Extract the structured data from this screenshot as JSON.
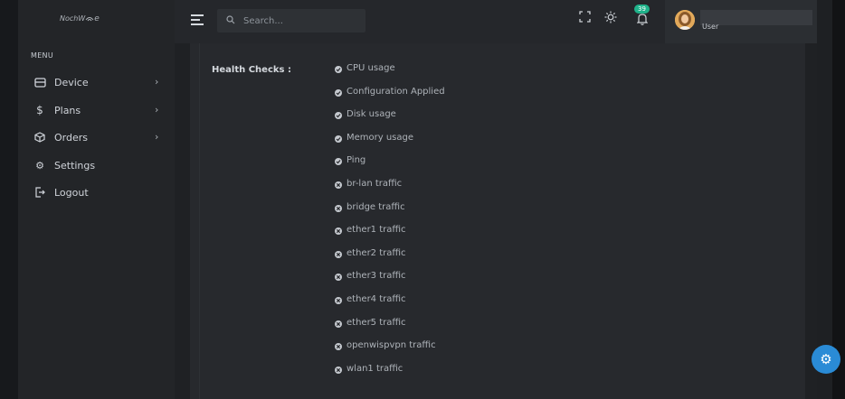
{
  "logo": {
    "text": "NochW",
    "tail": "e"
  },
  "sidebar": {
    "menu_title": "MENU",
    "items": [
      {
        "label": "Device",
        "icon": "device-icon",
        "has_submenu": true
      },
      {
        "label": "Plans",
        "icon": "dollar-icon",
        "has_submenu": true
      },
      {
        "label": "Orders",
        "icon": "box-icon",
        "has_submenu": true
      },
      {
        "label": "Settings",
        "icon": "gear-icon",
        "has_submenu": false
      },
      {
        "label": "Logout",
        "icon": "logout-icon",
        "has_submenu": false
      }
    ]
  },
  "header": {
    "search_placeholder": "Search...",
    "notification_count": "39",
    "user_role": "User"
  },
  "main": {
    "health_label": "Health Checks :",
    "checks": [
      {
        "label": "CPU usage",
        "status": "ok"
      },
      {
        "label": "Configuration Applied",
        "status": "ok"
      },
      {
        "label": "Disk usage",
        "status": "ok"
      },
      {
        "label": "Memory usage",
        "status": "ok"
      },
      {
        "label": "Ping",
        "status": "ok"
      },
      {
        "label": "br-lan traffic",
        "status": "fail"
      },
      {
        "label": "bridge traffic",
        "status": "fail"
      },
      {
        "label": "ether1 traffic",
        "status": "fail"
      },
      {
        "label": "ether2 traffic",
        "status": "fail"
      },
      {
        "label": "ether3 traffic",
        "status": "fail"
      },
      {
        "label": "ether4 traffic",
        "status": "fail"
      },
      {
        "label": "ether5 traffic",
        "status": "fail"
      },
      {
        "label": "openwispvpn traffic",
        "status": "fail"
      },
      {
        "label": "wlan1 traffic",
        "status": "fail"
      }
    ]
  },
  "colors": {
    "accent": "#1fb28a",
    "fab": "#2a8bd6"
  }
}
